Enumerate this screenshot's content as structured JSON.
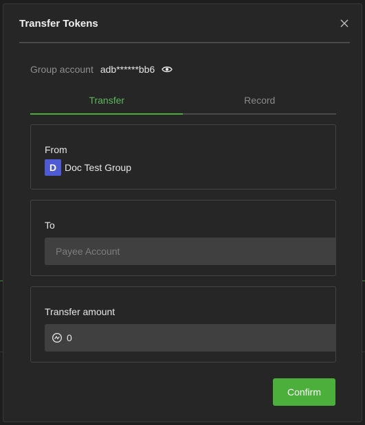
{
  "dialog": {
    "title": "Transfer Tokens"
  },
  "group_account": {
    "label": "Group account",
    "value": "adb******bb6"
  },
  "tabs": [
    {
      "label": "Transfer",
      "active": true
    },
    {
      "label": "Record",
      "active": false
    }
  ],
  "from": {
    "label": "From",
    "avatar_letter": "D",
    "group_name": "Doc Test Group"
  },
  "to": {
    "label": "To",
    "placeholder": "Payee Account",
    "value": ""
  },
  "amount": {
    "label": "Transfer amount",
    "value": "0"
  },
  "actions": {
    "confirm_label": "Confirm"
  },
  "icons": {
    "close": "close-icon",
    "eye": "eye-icon",
    "token": "token-icon"
  },
  "colors": {
    "accent": "#4caf3c",
    "avatar": "#4f5bd5",
    "background": "#262626"
  }
}
